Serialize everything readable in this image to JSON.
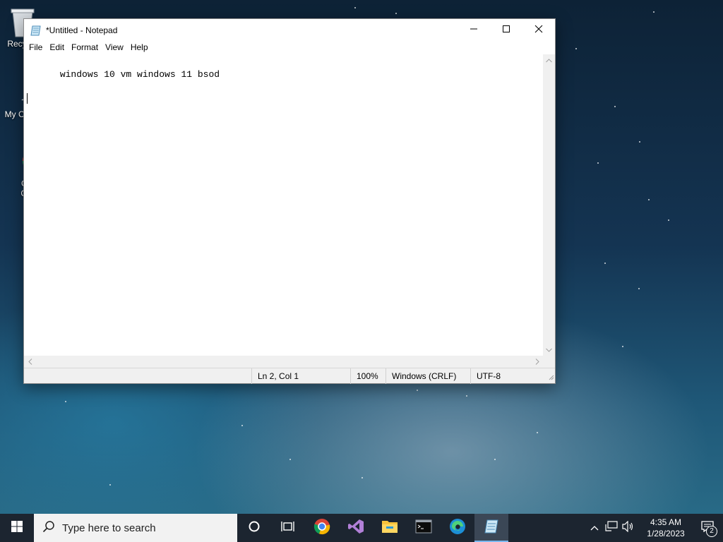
{
  "desktop": {
    "icons": [
      {
        "label": "Recy",
        "icon": "recycle-bin-icon"
      },
      {
        "label": "My Co",
        "icon": "computer-icon"
      },
      {
        "label_line1": "Go",
        "label_line2": "Ch",
        "icon": "chrome-shortcut-icon"
      }
    ]
  },
  "window": {
    "title": "*Untitled - Notepad",
    "controls": {
      "minimize": "minimize-icon",
      "maximize": "maximize-icon",
      "close": "close-icon"
    },
    "menu": [
      "File",
      "Edit",
      "Format",
      "View",
      "Help"
    ],
    "editor": {
      "line1": "windows 10 vm windows 11 bsod"
    },
    "status": {
      "position": "Ln 2, Col 1",
      "zoom": "100%",
      "line_ending": "Windows (CRLF)",
      "encoding": "UTF-8"
    }
  },
  "taskbar": {
    "search_placeholder": "Type here to search",
    "apps": [
      "cortana-icon",
      "task-view-icon",
      "chrome-icon",
      "visual-studio-icon",
      "file-explorer-icon",
      "terminal-icon",
      "edge-icon",
      "notepad-icon"
    ],
    "clock": {
      "time": "4:35 AM",
      "date": "1/28/2023"
    },
    "notification_count": "2"
  },
  "colors": {
    "taskbar_bg": "#1c2530",
    "search_bg": "#f2f2f2",
    "active_indicator": "#7ab8f0"
  }
}
